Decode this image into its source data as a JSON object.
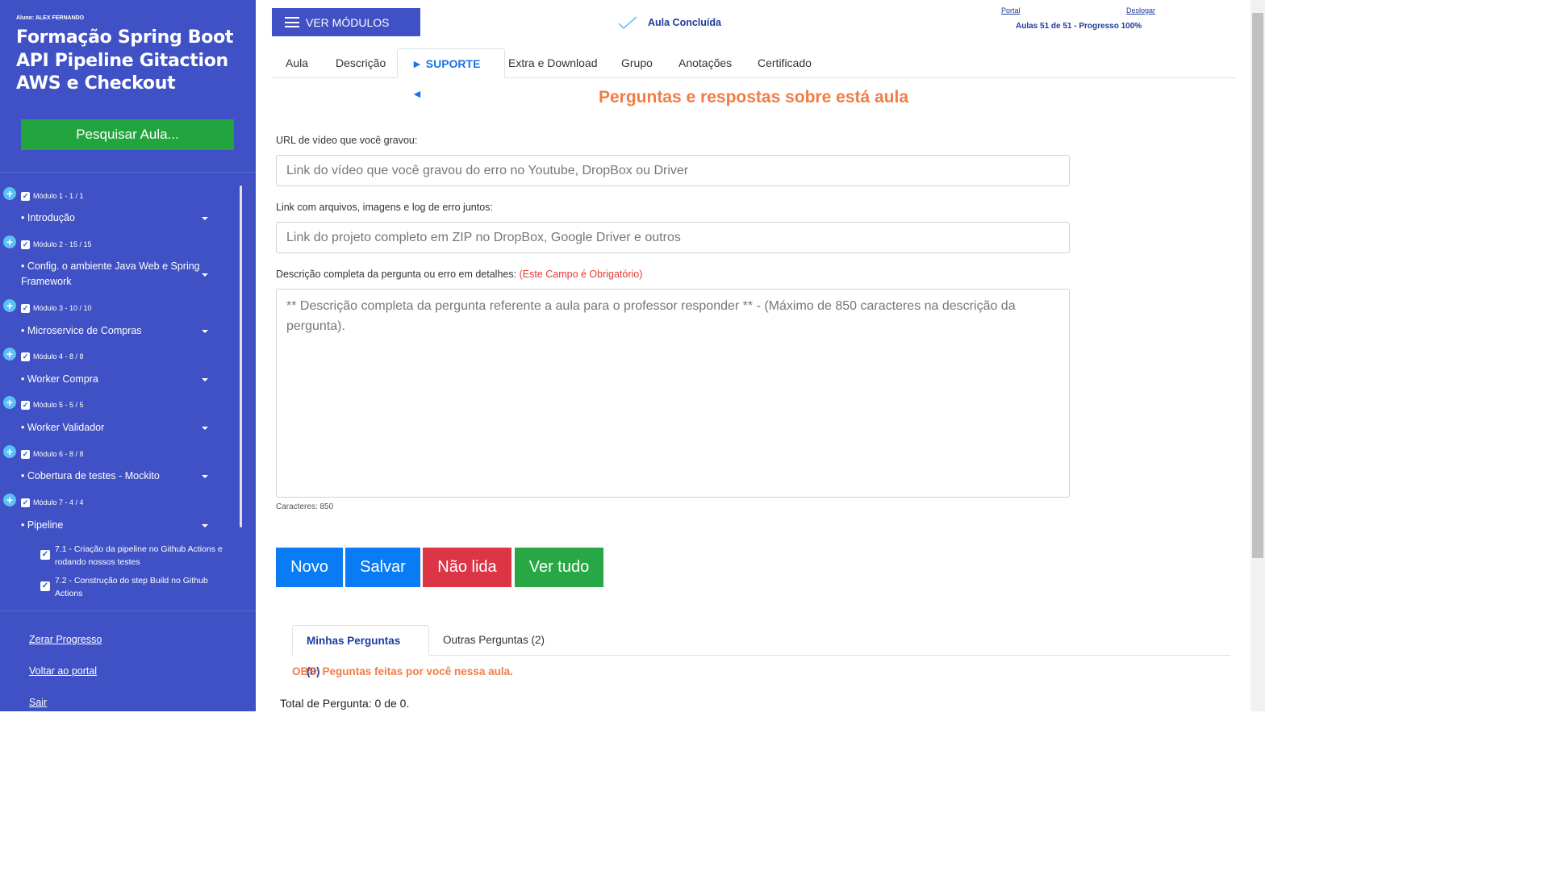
{
  "sidebar": {
    "student": "Aluno: ALEX FERNANDO",
    "course_title": "Formação Spring Boot API Pipeline Gitaction AWS e Checkout",
    "search_button": "Pesquisar Aula...",
    "modules": [
      {
        "label": "Módulo 1 - 1 / 1",
        "item": "• Introdução"
      },
      {
        "label": "Módulo 2 - 15 / 15",
        "item": "• Config. o ambiente Java Web e Spring Framework"
      },
      {
        "label": "Módulo 3 - 10 / 10",
        "item": "• Microservice de Compras"
      },
      {
        "label": "Módulo 4 - 8 / 8",
        "item": "• Worker Compra"
      },
      {
        "label": "Módulo 5 - 5 / 5",
        "item": "• Worker Validador"
      },
      {
        "label": "Módulo 6 - 8 / 8",
        "item": "• Cobertura de testes - Mockito"
      },
      {
        "label": "Módulo 7 - 4 / 4",
        "item": "• Pipeline"
      }
    ],
    "lessons": [
      "7.1 - Criação da pipeline no Github Actions e rodando nossos testes",
      "7.2 - Construção do step Build no Github Actions"
    ],
    "links": {
      "reset": "Zerar Progresso",
      "back": "Voltar ao portal",
      "exit": "Sair"
    }
  },
  "header": {
    "ver_modulos": "VER MÓDULOS",
    "aula_concluida": "Aula Concluída",
    "portal": "Portal",
    "deslogar": "Deslogar",
    "progress": "Aulas 51 de 51 - Progresso 100%"
  },
  "tabs": [
    "Aula",
    "Descrição",
    "► SUPORTE ◄",
    "Extra e Download",
    "Grupo",
    "Anotações",
    "Certificado"
  ],
  "support": {
    "title": "Perguntas e respostas sobre está aula",
    "url_label": "URL de vídeo que você gravou:",
    "url_placeholder": "Link do vídeo que você gravou do erro no Youtube, DropBox ou Driver",
    "files_label": "Link com arquivos, imagens e log de erro juntos:",
    "files_placeholder": "Link do projeto completo em ZIP no DropBox, Google Driver e outros",
    "desc_label": "Descrição completa da pergunta ou erro em detalhes:",
    "desc_required": "(Este Campo é Obrigatório)",
    "desc_placeholder": "** Descrição completa da pergunta referente a aula para o professor responder ** - (Máximo de 850 caracteres na descrição da pergunta).",
    "char_count": "Caracteres: 850"
  },
  "buttons": {
    "novo": "Novo",
    "salvar": "Salvar",
    "nao_lida": "Não lida",
    "ver_tudo": "Ver tudo"
  },
  "question_tabs": {
    "mine": "Minhas Perguntas (0)",
    "others": "Outras Perguntas (2)"
  },
  "obs": "OBS: Peguntas feitas por você nessa aula.",
  "total": "Total de Pergunta: 0 de 0.",
  "colors": {
    "sidebar": "#3f51c4",
    "search_green": "#22a53e",
    "accent_orange": "#f27c44",
    "btn_blue": "#0a7cf3",
    "btn_red": "#dc3545",
    "btn_green": "#28a745",
    "link_blue": "#1f3a9e"
  }
}
